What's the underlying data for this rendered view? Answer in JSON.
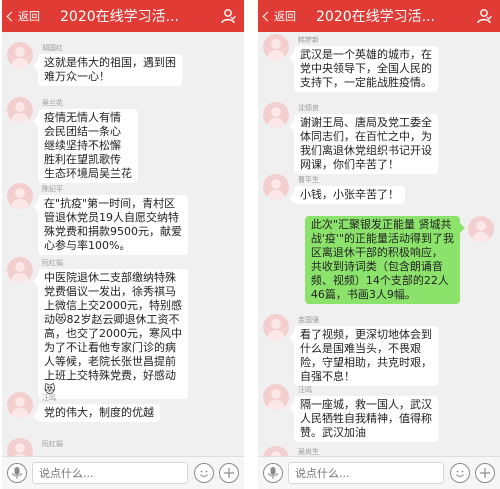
{
  "left": {
    "header": {
      "back_label": "返回",
      "title": "2020在线学习活..."
    },
    "messages": [
      {
        "name": "胡国红",
        "text": "这就是伟大的祖国，遇到困\n难万众一心！"
      },
      {
        "name": "吴兰花",
        "text": "疫情无情人有情\n会民团结一条心\n继续坚持不松懈\n胜利在望凯歌传\n生态环境局吴兰花"
      },
      {
        "name": "陈纪平",
        "text": "在\"抗疫\"第一时间，青村区\n管退休党员19人自愿交纳特\n殊党费和捐款9500元，献爱\n心参与率100%。"
      },
      {
        "name": "阮红娟",
        "text": "中医院退休二支部缴纳特殊\n党费倡议一发出，徐秀祺马\n上微信上交2000元，特别感\n动😻82岁赵云卿退休工资不\n高，也交了2000元，寒风中\n为了不让看他专家门诊的病\n人等候，老院长张世昌提前\n上班上交特殊党费，好感动\n😻"
      },
      {
        "name": "汪鸣",
        "text": "党的伟大，制度的优越"
      },
      {
        "name": "阮红娟",
        "text": ""
      }
    ],
    "input": {
      "placeholder": "说点什么..."
    }
  },
  "right": {
    "header": {
      "back_label": "返回",
      "title": "2020在线学习活..."
    },
    "messages": [
      {
        "name": "韩梦新",
        "text": "武汉是一个英雄的城市，在\n党中央领导下，全国人民的\n支持下，一定能战胜疫情。"
      },
      {
        "name": "沈德良",
        "text": "谢谢王局、唐局及党工委全\n体同志们，在百忙之中，为\n我们离退休党组织书记开设\n网课，你们辛苦了！"
      },
      {
        "name": "曹平生",
        "text": "小钱，小张辛苦了！"
      },
      {
        "name": "",
        "text": "此次\"汇聚银发正能量 贤城共\n战'疫'\"的正能量活动得到了我\n区离退休干部的积极响应，\n共收到诗词类（包含朗诵音\n频、视频）14个支部的22人\n46篇，书画3人9幅。"
      },
      {
        "name": "金国强",
        "text": "看了视频，更深切地体会到\n什么是国难当头，不畏艰\n险，守望相助，共克时艰，\n自强不息！"
      },
      {
        "name": "汪鸣",
        "text": "隔一座城，救一国人，武汉\n人民牺牲自我精神，值得称\n赞。武汉加油"
      },
      {
        "name": "吴尚生",
        "text": ""
      }
    ],
    "input": {
      "placeholder": "说点什么..."
    }
  },
  "colors": {
    "header_red": "#e13b36",
    "self_bubble_green": "#8be36b",
    "chat_bg": "#f0f0f0"
  }
}
